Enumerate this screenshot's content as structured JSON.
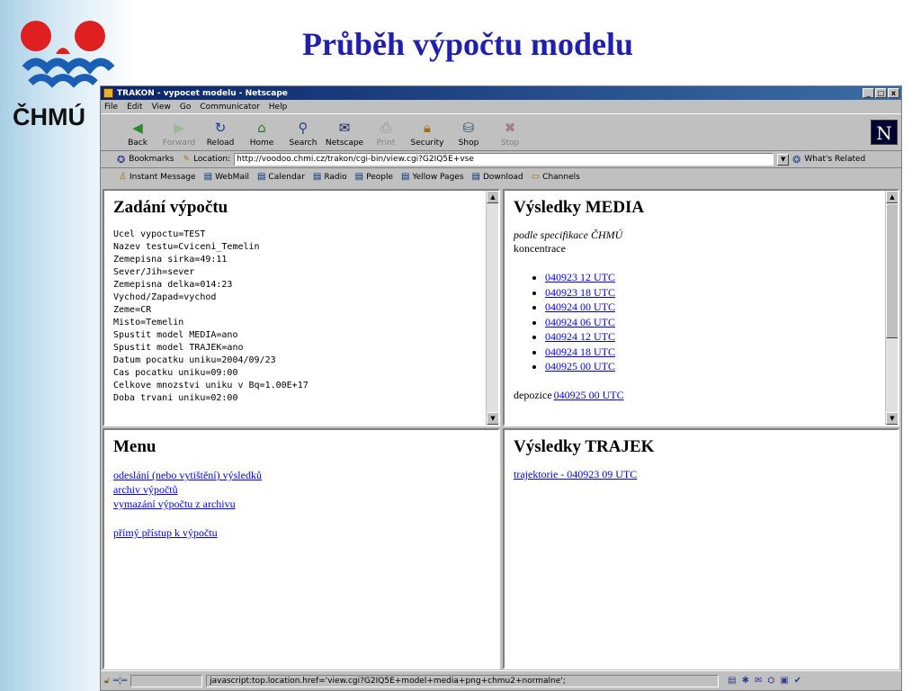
{
  "slide": {
    "title": "Průběh výpočtu modelu",
    "logo_text": "ČHMÚ"
  },
  "window": {
    "title": "TRAKON - vypocet modelu - Netscape",
    "controls": [
      "_",
      "□",
      "x"
    ]
  },
  "menubar": [
    "File",
    "Edit",
    "View",
    "Go",
    "Communicator",
    "Help"
  ],
  "toolbar": {
    "buttons": [
      {
        "label": "Back",
        "icon": "back-arrow-icon",
        "enabled": true
      },
      {
        "label": "Forward",
        "icon": "forward-arrow-icon",
        "enabled": false
      },
      {
        "label": "Reload",
        "icon": "reload-icon",
        "enabled": true
      },
      {
        "label": "Home",
        "icon": "home-icon",
        "enabled": true
      },
      {
        "label": "Search",
        "icon": "search-icon",
        "enabled": true
      },
      {
        "label": "Netscape",
        "icon": "netscape-icon",
        "enabled": true
      },
      {
        "label": "Print",
        "icon": "print-icon",
        "enabled": false
      },
      {
        "label": "Security",
        "icon": "lock-icon",
        "enabled": true
      },
      {
        "label": "Shop",
        "icon": "shop-icon",
        "enabled": true
      },
      {
        "label": "Stop",
        "icon": "stop-icon",
        "enabled": false
      }
    ],
    "logo_letter": "N"
  },
  "locationbar": {
    "bookmarks_label": "Bookmarks",
    "location_label": "Location:",
    "url": "http://voodoo.chmi.cz/trakon/cgi-bin/view.cgi?G2IQ5E+vse",
    "whats_related": "What's Related"
  },
  "personalbar": [
    "Instant Message",
    "WebMail",
    "Calendar",
    "Radio",
    "People",
    "Yellow Pages",
    "Download",
    "Channels"
  ],
  "zadani": {
    "heading": "Zadání výpočtu",
    "lines": [
      "Ucel vypoctu=TEST",
      "Nazev testu=Cviceni_Temelin",
      "Zemepisna sirka=49:11",
      "Sever/Jih=sever",
      "Zemepisna delka=014:23",
      "Vychod/Zapad=vychod",
      "Zeme=CR",
      "Misto=Temelin",
      "Spustit model MEDIA=ano",
      "Spustit model TRAJEK=ano",
      "Datum pocatku uniku=2004/09/23",
      "Cas pocatku uniku=09:00",
      "Celkove mnozstvi uniku v Bq=1.00E+17",
      "Doba trvani uniku=02:00"
    ]
  },
  "media": {
    "heading": "Výsledky MEDIA",
    "subtitle": "podle specifikace ČHMÚ",
    "konc_label": "koncentrace",
    "konc_links": [
      "040923 12 UTC",
      "040923 18 UTC",
      "040924 00 UTC",
      "040924 06 UTC",
      "040924 12 UTC",
      "040924 18 UTC",
      "040925 00 UTC"
    ],
    "depozice_label": "depozice",
    "depozice_link": "040925 00 UTC"
  },
  "menu": {
    "heading": "Menu",
    "links": [
      "odeslání (nebo vytištění) výsledků",
      "archiv výpočtů",
      "vymazání výpočtu z archivu"
    ],
    "direct_link": "přímý přístup k výpočtu"
  },
  "trajek": {
    "heading": "Výsledky TRAJEK",
    "link": "trajektorie - 040923 09 UTC"
  },
  "statusbar": {
    "text": "javascript:top.location.href='view.cgi?G2IQ5E+model+media+png+chmu2+normalne';"
  }
}
